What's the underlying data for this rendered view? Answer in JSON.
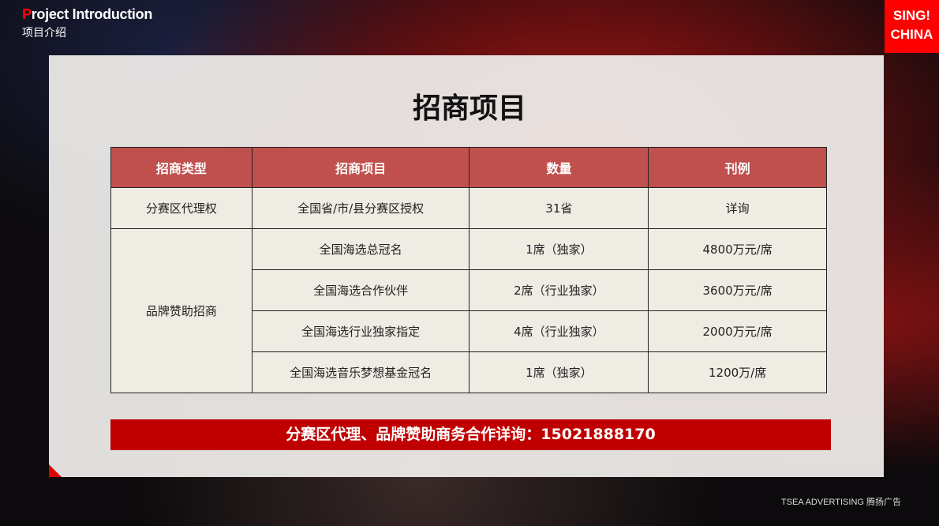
{
  "header": {
    "en_first": "P",
    "en_rest": "roject Introduction",
    "cn": "项目介绍"
  },
  "logo": {
    "line1": "SING!",
    "line2": "CHINA"
  },
  "title": "招商项目",
  "table": {
    "headers": [
      "招商类型",
      "招商项目",
      "数量",
      "刊例"
    ],
    "group1": {
      "type": "分赛区代理权",
      "rows": [
        [
          "全国省/市/县分赛区授权",
          "31省",
          "详询"
        ]
      ]
    },
    "group2": {
      "type": "品牌赞助招商",
      "rows": [
        [
          "全国海选总冠名",
          "1席（独家）",
          "4800万元/席"
        ],
        [
          "全国海选合作伙伴",
          "2席（行业独家）",
          "3600万元/席"
        ],
        [
          "全国海选行业独家指定",
          "4席（行业独家）",
          "2000万元/席"
        ],
        [
          "全国海选音乐梦想基金冠名",
          "1席（独家）",
          "1200万/席"
        ]
      ]
    }
  },
  "contact_bar": "分赛区代理、品牌赞助商务合作详询：15021888170",
  "footer": "TSEA ADVERTISING 腾扬广告"
}
